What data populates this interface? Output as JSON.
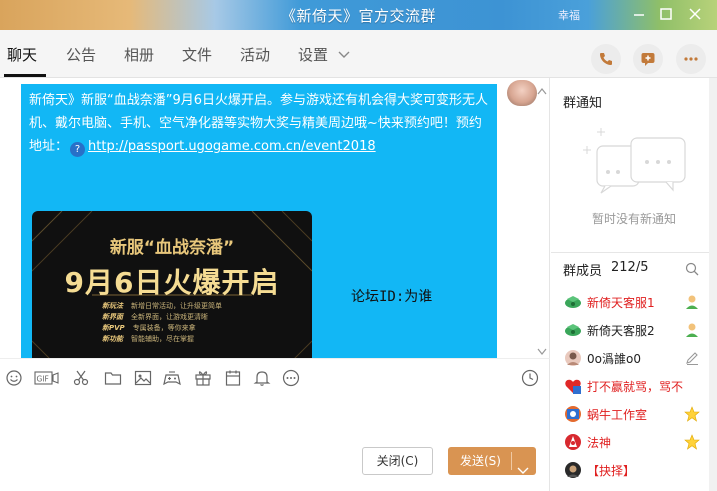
{
  "window": {
    "title": "《新倚天》官方交流群",
    "title_extra": "幸福"
  },
  "tabs": [
    {
      "label": "聊天",
      "active": true
    },
    {
      "label": "公告"
    },
    {
      "label": "相册"
    },
    {
      "label": "文件"
    },
    {
      "label": "活动"
    },
    {
      "label": "设置"
    }
  ],
  "chat": {
    "message_text": "新倚天》新服“血战奈潘”9月6日火爆开启。参与游戏还有机会得大奖可变形无人机、戴尔电脑、手机、空气净化器等实物大奖与精美周边哦~快来预约吧！预约地址：",
    "message_link": "http://passport.ugogame.com.cn/event2018",
    "banner": {
      "line1": "新服“血战奈潘”",
      "line2": "9月6日火爆开启",
      "items": [
        {
          "tag": "新玩法",
          "desc": "新增日常活动，让升级更简单"
        },
        {
          "tag": "新界面",
          "desc": "全新界面，让游戏更清晰"
        },
        {
          "tag": "新PVP",
          "desc": "专属装备，等你来拿"
        },
        {
          "tag": "新功能",
          "desc": "智能辅助，尽在掌握"
        }
      ]
    },
    "forum_id": "论坛ID:为谁"
  },
  "input": {
    "close_label": "关闭(C)",
    "send_label": "发送(S)"
  },
  "notice": {
    "title": "群通知",
    "empty": "暂时没有新通知"
  },
  "members": {
    "title": "群成员",
    "count": "212/5",
    "list": [
      {
        "name": "新倚天客服1",
        "color": "red"
      },
      {
        "name": "新倚天客服2",
        "color": "black"
      },
      {
        "name": "0o潙誰o0",
        "color": "black"
      },
      {
        "name": "打不赢就骂，骂不赢",
        "color": "red"
      },
      {
        "name": "蜗牛工作室",
        "color": "red"
      },
      {
        "name": "法神",
        "color": "red"
      },
      {
        "name": "【抉择】",
        "color": "red"
      }
    ]
  },
  "colors": {
    "bubble": "#12b7f5",
    "send": "#d99452",
    "member_red": "#e02020"
  }
}
